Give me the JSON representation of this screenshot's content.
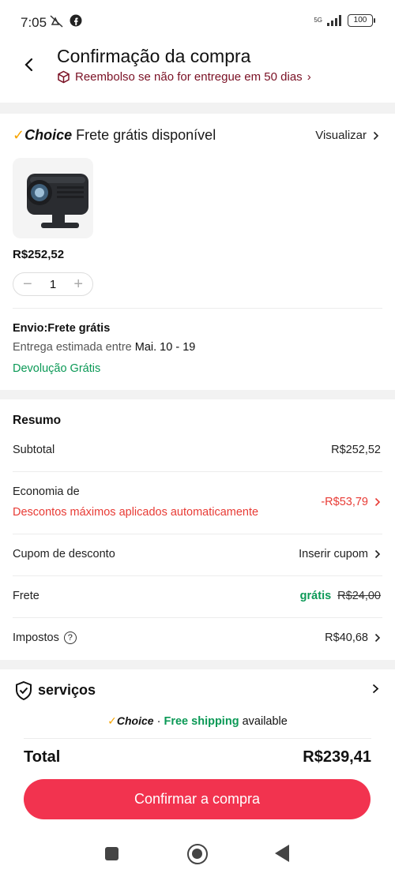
{
  "status_bar": {
    "time": "7:05",
    "network": "5G",
    "battery": "100"
  },
  "header": {
    "title": "Confirmação da compra",
    "refund_text": "Reembolso se não for entregue em 50 dias",
    "refund_chevron": "›"
  },
  "shipping_banner": {
    "brand": "Choice",
    "text": "Frete grátis disponível",
    "view_label": "Visualizar"
  },
  "product": {
    "image_icon": "projector-image",
    "price": "R$252,52",
    "quantity": "1",
    "minus": "−",
    "plus": "+"
  },
  "delivery": {
    "title": "Envio:Frete grátis",
    "estimate_label": "Entrega estimada entre",
    "estimate_dates": "Mai. 10 - 19",
    "free_return": "Devolução Grátis"
  },
  "summary": {
    "title": "Resumo",
    "subtotal_label": "Subtotal",
    "subtotal_value": "R$252,52",
    "savings_label": "Economia de",
    "savings_note": "Descontos máximos aplicados automaticamente",
    "savings_value": "-R$53,79",
    "coupon_label": "Cupom de desconto",
    "coupon_value": "Inserir cupom",
    "shipping_label": "Frete",
    "shipping_free": "grátis",
    "shipping_original": "R$24,00",
    "taxes_label": "Impostos",
    "taxes_value": "R$40,68"
  },
  "services": {
    "title": "serviços",
    "promo_brand": "Choice",
    "promo_sep": "·",
    "promo_free": "Free shipping",
    "promo_available": "available"
  },
  "footer": {
    "total_label": "Total",
    "total_value": "R$239,41",
    "confirm_label": "Confirmar a compra"
  },
  "colors": {
    "accent": "#f2334f",
    "discount_red": "#e83b35",
    "green": "#0b9956",
    "choice_check": "#f7a400"
  }
}
